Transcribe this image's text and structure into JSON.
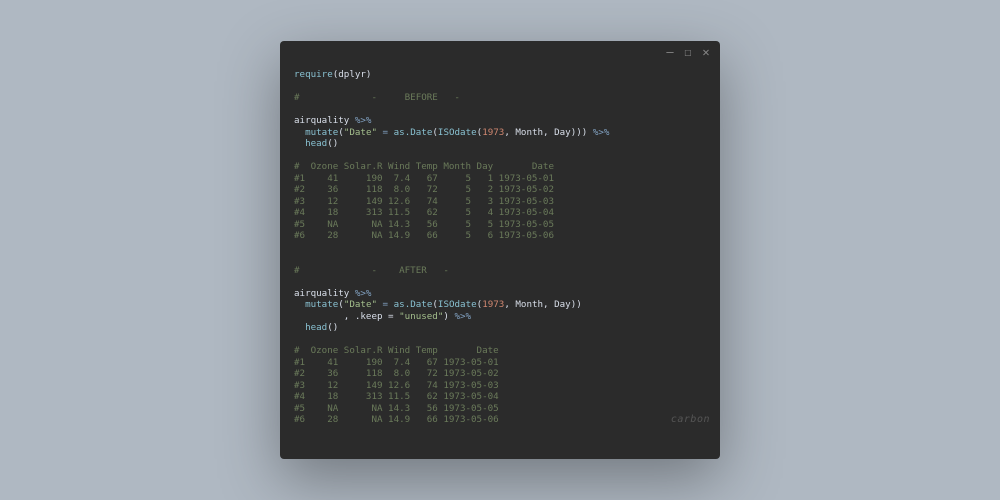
{
  "window": {
    "controls": {
      "minimize": "—",
      "maximize": "☐",
      "close": "✕"
    }
  },
  "watermark": {
    "main": "carbon",
    "sub": ""
  },
  "code": {
    "l01_a": "require",
    "l01_b": "(dplyr)",
    "l02": "#             -     BEFORE   -",
    "l03_a": "airquality ",
    "l03_b": "%>%",
    "l04_a": "  mutate",
    "l04_b": "(",
    "l04_c": "\"Date\"",
    "l04_d": " = ",
    "l04_e": "as.Date",
    "l04_f": "(",
    "l04_g": "ISOdate",
    "l04_h": "(",
    "l04_i": "1973",
    "l04_j": ", Month, Day))) ",
    "l04_k": "%>%",
    "l05_a": "  head",
    "l05_b": "()",
    "t1h": "#  Ozone Solar.R Wind Temp Month Day       Date",
    "t1r1": "#1    41     190  7.4   67     5   1 1973-05-01",
    "t1r2": "#2    36     118  8.0   72     5   2 1973-05-02",
    "t1r3": "#3    12     149 12.6   74     5   3 1973-05-03",
    "t1r4": "#4    18     313 11.5   62     5   4 1973-05-04",
    "t1r5": "#5    NA      NA 14.3   56     5   5 1973-05-05",
    "t1r6": "#6    28      NA 14.9   66     5   6 1973-05-06",
    "l10": "#             -    AFTER   -",
    "l11_a": "airquality ",
    "l11_b": "%>%",
    "l12_a": "  mutate",
    "l12_b": "(",
    "l12_c": "\"Date\"",
    "l12_d": " = ",
    "l12_e": "as.Date",
    "l12_f": "(",
    "l12_g": "ISOdate",
    "l12_h": "(",
    "l12_i": "1973",
    "l12_j": ", Month, Day))",
    "l13_a": "         , .keep = ",
    "l13_b": "\"unused\"",
    "l13_c": ") ",
    "l13_d": "%>%",
    "l14_a": "  head",
    "l14_b": "()",
    "t2h": "#  Ozone Solar.R Wind Temp       Date",
    "t2r1": "#1    41     190  7.4   67 1973-05-01",
    "t2r2": "#2    36     118  8.0   72 1973-05-02",
    "t2r3": "#3    12     149 12.6   74 1973-05-03",
    "t2r4": "#4    18     313 11.5   62 1973-05-04",
    "t2r5": "#5    NA      NA 14.3   56 1973-05-05",
    "t2r6": "#6    28      NA 14.9   66 1973-05-06"
  }
}
